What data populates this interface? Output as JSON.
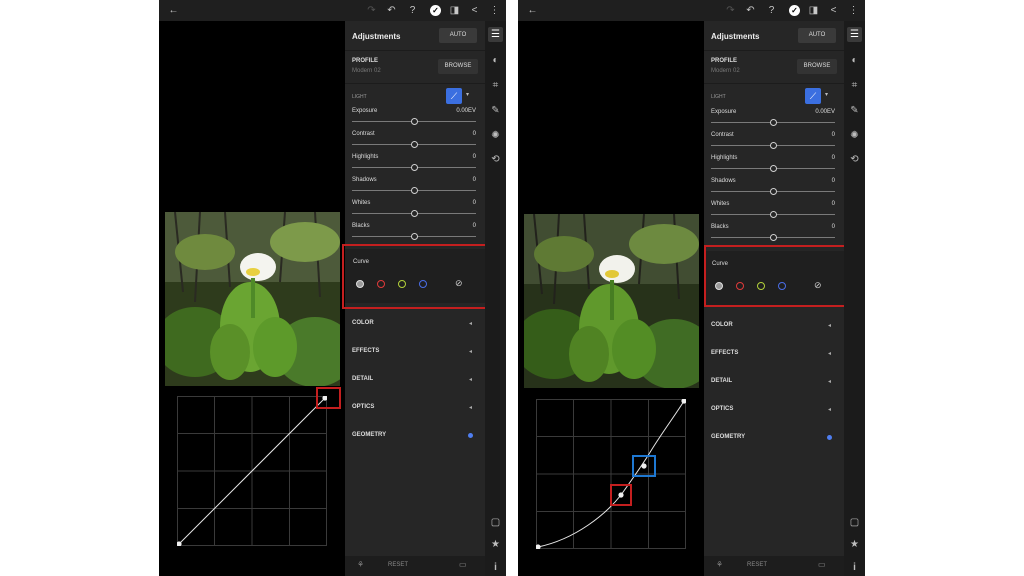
{
  "topbar_icons": {
    "back": "←",
    "redo": "↷",
    "undo": "↶",
    "help": "?",
    "done": "✓",
    "compare": "◨",
    "share": "<",
    "more": "⋮"
  },
  "panel": {
    "title": "Adjustments",
    "auto_label": "AUTO",
    "profile_label": "PROFILE",
    "profile_value": "Modern 02",
    "browse_label": "BROWSE",
    "light_label": "LIGHT",
    "tone_icon": "⟋",
    "tone_caret": "▾",
    "sliders": [
      {
        "label": "Exposure",
        "value": "0.00EV",
        "position": 0.5
      },
      {
        "label": "Contrast",
        "value": "0",
        "position": 0.5
      },
      {
        "label": "Highlights",
        "value": "0",
        "position": 0.5
      },
      {
        "label": "Shadows",
        "value": "0",
        "position": 0.5
      },
      {
        "label": "Whites",
        "value": "0",
        "position": 0.5
      },
      {
        "label": "Blacks",
        "value": "0",
        "position": 0.5
      }
    ],
    "curve_label": "Curve",
    "curve_mix_icon": "⊘",
    "sections": [
      {
        "label": "COLOR",
        "marker": "◂"
      },
      {
        "label": "EFFECTS",
        "marker": "◂"
      },
      {
        "label": "DETAIL",
        "marker": "◂"
      },
      {
        "label": "OPTICS",
        "marker": "◂"
      },
      {
        "label": "GEOMETRY",
        "marker": ""
      }
    ],
    "reset_label": "RESET",
    "reset_left_icon": "⚘",
    "reset_right_icon": "▭"
  },
  "tools": {
    "adjust": "☰",
    "presets": "◐",
    "crop": "⌗",
    "heal": "✎",
    "masking": "✺",
    "history": "⟲",
    "comment": "▢",
    "star": "★",
    "info": "i"
  },
  "colors": {
    "highlight_red": "#c41f1f",
    "highlight_blue": "#1e78d2",
    "accent_blue": "#3b6fe0"
  }
}
